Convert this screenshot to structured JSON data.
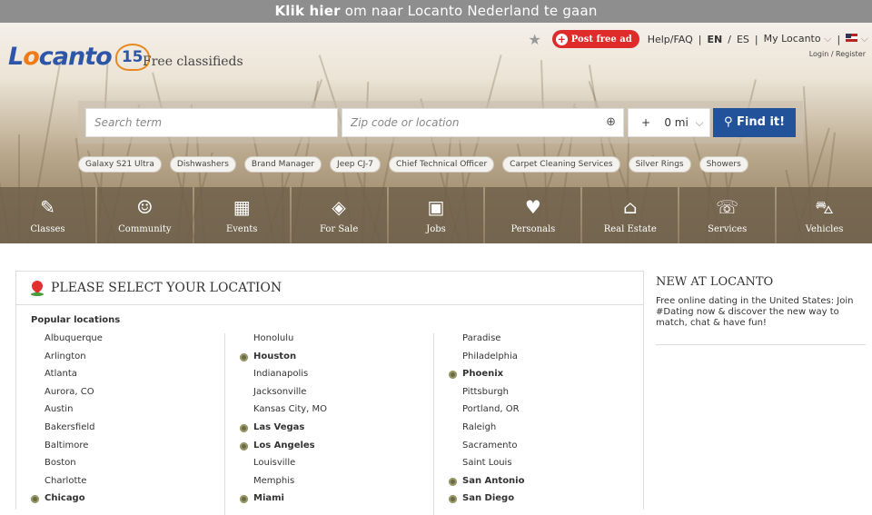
{
  "topbar": {
    "bold": "Klik hier",
    "rest": "om naar Locanto Nederland te gaan"
  },
  "header": {
    "logo_text_start": "L",
    "logo_text_o": "o",
    "logo_text_end": "canto",
    "logo_badge": "15",
    "tagline": "Free classifieds",
    "post_ad": "Post free ad",
    "help": "Help/FAQ",
    "lang_en": "EN",
    "lang_sep": "/",
    "lang_es": "ES",
    "my_locanto": "My Locanto",
    "login": "Login / Register"
  },
  "search": {
    "term_placeholder": "Search term",
    "location_placeholder": "Zip code or location",
    "radius_plus": "+",
    "radius_value": "0 mi",
    "find_label": "Find it!"
  },
  "tags": [
    "Galaxy S21 Ultra",
    "Dishwashers",
    "Brand Manager",
    "Jeep CJ-7",
    "Chief Technical Officer",
    "Carpet Cleaning Services",
    "Silver Rings",
    "Showers"
  ],
  "categories": [
    {
      "label": "Classes",
      "icon": "classes-icon"
    },
    {
      "label": "Community",
      "icon": "community-icon"
    },
    {
      "label": "Events",
      "icon": "calendar-icon"
    },
    {
      "label": "For Sale",
      "icon": "price-tag-icon"
    },
    {
      "label": "Jobs",
      "icon": "briefcase-icon"
    },
    {
      "label": "Personals",
      "icon": "heart-icon"
    },
    {
      "label": "Real Estate",
      "icon": "house-icon"
    },
    {
      "label": "Services",
      "icon": "phone-icon"
    },
    {
      "label": "Vehicles",
      "icon": "car-icon"
    }
  ],
  "location_panel": {
    "title": "PLEASE SELECT YOUR LOCATION",
    "popular": "Popular locations",
    "columns": [
      [
        {
          "name": "Albuquerque",
          "bold": false
        },
        {
          "name": "Arlington",
          "bold": false
        },
        {
          "name": "Atlanta",
          "bold": false
        },
        {
          "name": "Aurora, CO",
          "bold": false
        },
        {
          "name": "Austin",
          "bold": false
        },
        {
          "name": "Bakersfield",
          "bold": false
        },
        {
          "name": "Baltimore",
          "bold": false
        },
        {
          "name": "Boston",
          "bold": false
        },
        {
          "name": "Charlotte",
          "bold": false
        },
        {
          "name": "Chicago",
          "bold": true
        }
      ],
      [
        {
          "name": "Honolulu",
          "bold": false
        },
        {
          "name": "Houston",
          "bold": true
        },
        {
          "name": "Indianapolis",
          "bold": false
        },
        {
          "name": "Jacksonville",
          "bold": false
        },
        {
          "name": "Kansas City, MO",
          "bold": false
        },
        {
          "name": "Las Vegas",
          "bold": true
        },
        {
          "name": "Los Angeles",
          "bold": true
        },
        {
          "name": "Louisville",
          "bold": false
        },
        {
          "name": "Memphis",
          "bold": false
        },
        {
          "name": "Miami",
          "bold": true
        }
      ],
      [
        {
          "name": "Paradise",
          "bold": false
        },
        {
          "name": "Philadelphia",
          "bold": false
        },
        {
          "name": "Phoenix",
          "bold": true
        },
        {
          "name": "Pittsburgh",
          "bold": false
        },
        {
          "name": "Portland, OR",
          "bold": false
        },
        {
          "name": "Raleigh",
          "bold": false
        },
        {
          "name": "Sacramento",
          "bold": false
        },
        {
          "name": "Saint Louis",
          "bold": false
        },
        {
          "name": "San Antonio",
          "bold": true
        },
        {
          "name": "San Diego",
          "bold": true
        }
      ]
    ]
  },
  "news": {
    "title": "NEW AT LOCANTO",
    "text": "Free online dating in the United States: Join #Dating now & discover the new way to match, chat & have fun!"
  },
  "colors": {
    "brand_blue": "#2d55a8",
    "brand_orange": "#f07a16",
    "post_red": "#e02b2b",
    "find_blue": "#22529a"
  }
}
